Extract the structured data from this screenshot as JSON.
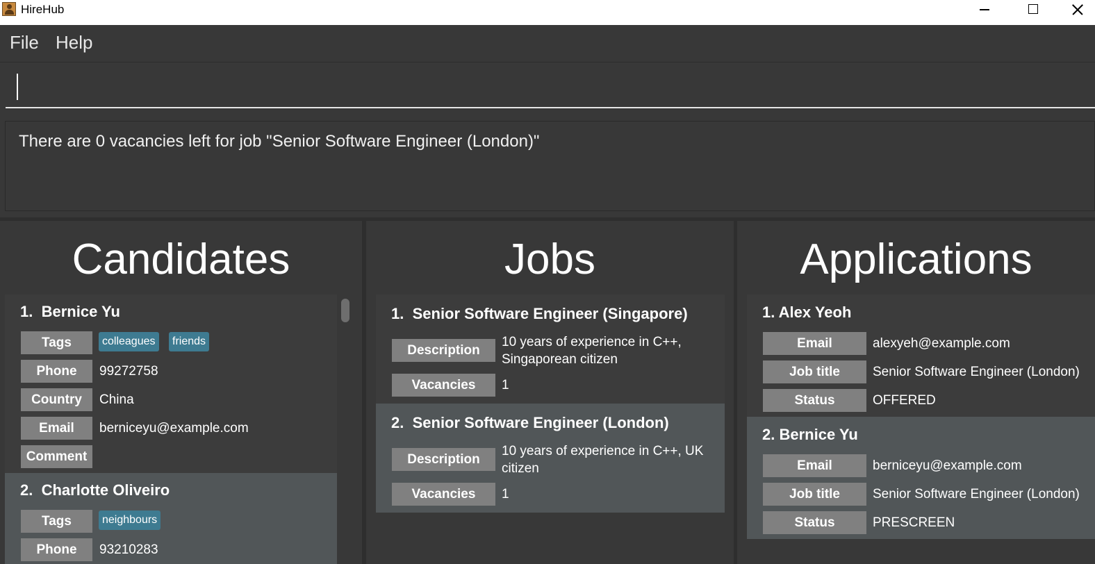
{
  "window": {
    "title": "HireHub"
  },
  "menu": {
    "file": "File",
    "help": "Help"
  },
  "command": {
    "value": ""
  },
  "result": {
    "message": "There are 0 vacancies left for job \"Senior Software Engineer (London)\""
  },
  "candidates": {
    "title": "Candidates",
    "labels": {
      "tags": "Tags",
      "phone": "Phone",
      "country": "Country",
      "email": "Email",
      "comment": "Comment"
    },
    "items": [
      {
        "index": "1.",
        "name": "Bernice Yu",
        "tags": [
          "colleagues",
          "friends"
        ],
        "phone": "99272758",
        "country": "China",
        "email": "berniceyu@example.com",
        "comment": ""
      },
      {
        "index": "2.",
        "name": "Charlotte Oliveiro",
        "tags": [
          "neighbours"
        ],
        "phone": "93210283"
      }
    ]
  },
  "jobs": {
    "title": "Jobs",
    "labels": {
      "description": "Description",
      "vacancies": "Vacancies"
    },
    "items": [
      {
        "index": "1.",
        "title": "Senior Software Engineer (Singapore)",
        "description_line1": "10 years of experience in C++,",
        "description_line2": "Singaporean citizen",
        "vacancies": "1"
      },
      {
        "index": "2.",
        "title": "Senior Software Engineer (London)",
        "description_line1": "10 years of experience in C++, UK",
        "description_line2": "citizen",
        "vacancies": "1"
      }
    ]
  },
  "applications": {
    "title": "Applications",
    "labels": {
      "email": "Email",
      "job_title": "Job title",
      "status": "Status"
    },
    "items": [
      {
        "index": "1.",
        "name": "Alex Yeoh",
        "email": "alexyeh@example.com",
        "job_title": "Senior Software Engineer (London)",
        "status": "OFFERED"
      },
      {
        "index": "2.",
        "name": "Bernice Yu",
        "email": "berniceyu@example.com",
        "job_title": "Senior Software Engineer (London)",
        "status": "PRESCREEN"
      }
    ]
  },
  "colors": {
    "background": "#383838",
    "card_alt": "#515658",
    "label_bg": "#808080",
    "tag_bg": "#3e7b91"
  }
}
